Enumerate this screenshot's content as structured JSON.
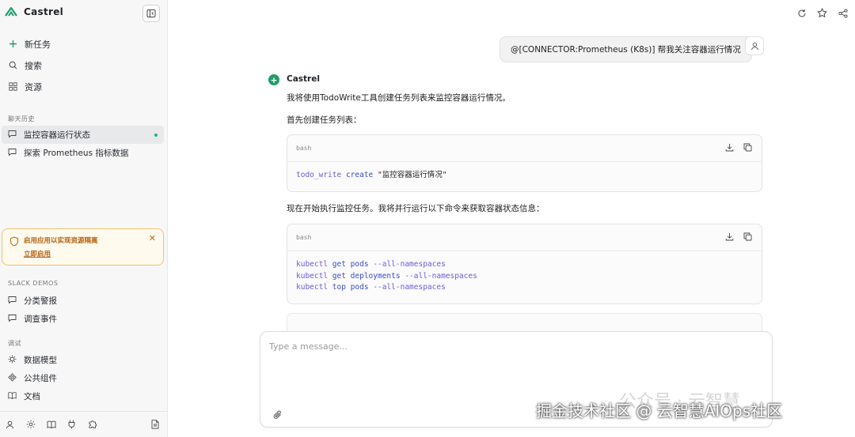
{
  "brand": {
    "name": "Castrel"
  },
  "nav": [
    {
      "icon": "plus-icon",
      "label": "新任务"
    },
    {
      "icon": "search-icon",
      "label": "搜索"
    },
    {
      "icon": "grid-icon",
      "label": "资源"
    }
  ],
  "history": {
    "section_label": "聊天历史",
    "items": [
      {
        "label": "监控容器运行状态",
        "active": true
      },
      {
        "label": "探索 Prometheus 指标数据",
        "active": false
      }
    ]
  },
  "promo": {
    "title": "启用应用以实现资源隔离",
    "link": "立即启用"
  },
  "slack": {
    "section_label": "SLACK DEMOS",
    "items": [
      {
        "label": "分类警报"
      },
      {
        "label": "调查事件"
      }
    ]
  },
  "debug": {
    "section_label": "调试",
    "items": [
      {
        "label": "数据模型"
      },
      {
        "label": "公共组件"
      },
      {
        "label": "文档"
      }
    ]
  },
  "chat": {
    "user_message": "@[CONNECTOR:Prometheus (K8s)] 帮我关注容器运行情况",
    "bot_name": "Castrel",
    "intro": "我将使用TodoWrite工具创建任务列表来监控容器运行情况。",
    "step1": "首先创建任务列表：",
    "code1": {
      "lang": "bash",
      "cmd": "todo_write",
      "sub": "create",
      "arg": "\"监控容器运行情况\""
    },
    "step2": "现在开始执行监控任务。我将并行运行以下命令来获取容器状态信息：",
    "code2": {
      "lang": "bash",
      "lines": [
        {
          "cmd": "kubectl",
          "sub": "get pods",
          "arg": "--all-namespaces"
        },
        {
          "cmd": "kubectl",
          "sub": "get deployments",
          "arg": "--all-namespaces"
        },
        {
          "cmd": "kubectl",
          "sub": "top pods",
          "arg": "--all-namespaces"
        }
      ]
    }
  },
  "composer": {
    "placeholder": "Type a message..."
  },
  "watermark": {
    "main": "掘金技术社区 @ 云智慧AIOps社区",
    "faint": "公众号 · 云智慧"
  },
  "colors": {
    "accent": "#1f9d6a",
    "warning": "#b5620e",
    "keyword": "#6f5ad6"
  }
}
